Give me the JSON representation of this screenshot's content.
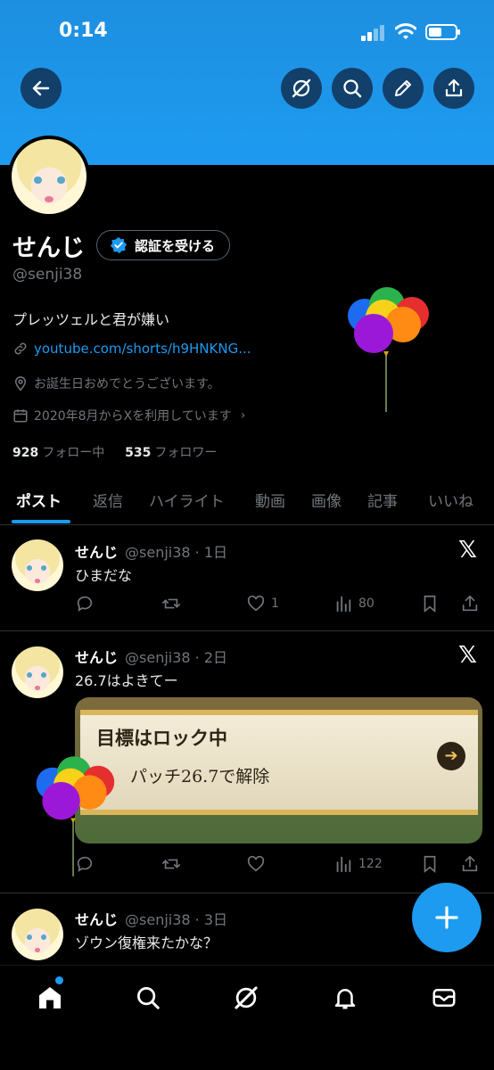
{
  "status_bar": {
    "time": "0:14"
  },
  "profile": {
    "name": "せんじ",
    "verify_button": "認証を受ける",
    "handle": "@senji38",
    "bio": "プレッツェルと君が嫌い",
    "link": "youtube.com/shorts/h9HNKNG...",
    "location": "お誕生日おめでとうございます。",
    "joined": "2020年8月からXを利用しています",
    "following_count": "928",
    "following_label": "フォロー中",
    "followers_count": "535",
    "followers_label": "フォロワー"
  },
  "tabs": [
    "ポスト",
    "返信",
    "ハイライト",
    "動画",
    "画像",
    "記事",
    "いいね"
  ],
  "posts": [
    {
      "name": "せんじ",
      "handle_time": "@senji38 · 1日",
      "text": "ひまだな",
      "likes": "1",
      "views": "80"
    },
    {
      "name": "せんじ",
      "handle_time": "@senji38 · 2日",
      "text": "26.7はよきてー",
      "views": "122",
      "media": {
        "line1": "目標はロック中",
        "line2": "パッチ26.7で解除"
      }
    },
    {
      "name": "せんじ",
      "handle_time": "@senji38 · 3日",
      "text": "ゾウン復権来たかな？"
    }
  ],
  "colors": {
    "accent": "#1d9bf0",
    "background": "#000000",
    "muted": "#71767b"
  },
  "icons": [
    "back-arrow-icon",
    "grok-icon",
    "search-icon",
    "edit-icon",
    "share-icon",
    "balloon-icon",
    "x-logo-icon",
    "reply-icon",
    "repost-icon",
    "like-icon",
    "views-icon",
    "bookmark-icon",
    "home-icon",
    "bell-icon",
    "mail-icon",
    "plus-icon"
  ]
}
